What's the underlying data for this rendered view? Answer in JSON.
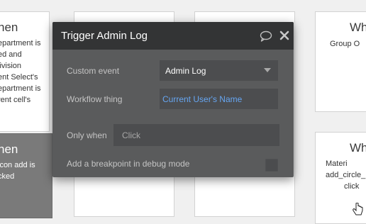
{
  "cards": {
    "card1": {
      "title": "hen",
      "lines": [
        "epartment is",
        "ed and",
        "livision",
        "ent Select's",
        "epartment is",
        "rent cell's"
      ]
    },
    "card2": {
      "title": "hen",
      "lines": [
        "icon add is",
        "cked"
      ]
    },
    "card5": {
      "title": "Wh",
      "lines": [
        "Group O"
      ]
    },
    "card6": {
      "title": "Wh",
      "lines": [
        "Materi",
        "add_circle_",
        "click"
      ]
    }
  },
  "dialog": {
    "title": "Trigger Admin Log",
    "custom_event_label": "Custom event",
    "custom_event_value": "Admin Log",
    "workflow_thing_label": "Workflow thing",
    "workflow_thing_value": "Current User's Name",
    "only_when_label": "Only when",
    "only_when_placeholder": "Click",
    "breakpoint_label": "Add a breakpoint in debug mode",
    "breakpoint_checked": false
  },
  "icons": {
    "comment": "comment-icon",
    "close": "close-icon",
    "caret": "chevron-down-icon",
    "cursor": "hand-pointer-icon"
  },
  "colors": {
    "dialog_header": "#333435",
    "dialog_body": "#5a5b5c",
    "dynamic_value": "#66a6f2",
    "canvas": "#f0f0f0"
  }
}
